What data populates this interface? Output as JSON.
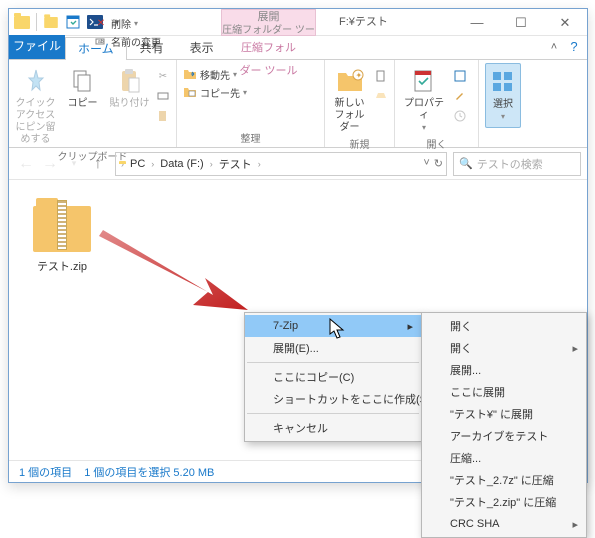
{
  "titlebar": {
    "contextual_header": "展開",
    "contextual_sub": "圧縮フォルダー ツール",
    "title": "F:¥テスト"
  },
  "winbtns": {
    "min": "—",
    "max": "☐",
    "close": "✕"
  },
  "tabs": {
    "file": "ファイル",
    "home": "ホーム",
    "share": "共有",
    "view": "表示"
  },
  "ribbon": {
    "clipboard": {
      "label": "クリップボード",
      "pin": "クイック アクセス\nにピン留めする",
      "copy": "コピー",
      "paste": "貼り付け"
    },
    "organize": {
      "label": "整理",
      "moveto": "移動先",
      "delete": "削除",
      "copyto": "コピー先",
      "rename": "名前の変更"
    },
    "new": {
      "label": "新規",
      "newfolder": "新しい\nフォルダー"
    },
    "open": {
      "label": "開く",
      "properties": "プロパティ"
    },
    "select": {
      "label": "",
      "select": "選択"
    }
  },
  "address": {
    "pc": "PC",
    "drive": "Data (F:)",
    "folder": "テスト"
  },
  "search": {
    "placeholder": "テストの検索"
  },
  "file": {
    "name": "テスト.zip"
  },
  "ctx1": {
    "sevenzip": "7-Zip",
    "expand": "展開(E)...",
    "copyhere": "ここにコピー(C)",
    "shortcut": "ショートカットをここに作成(S)",
    "cancel": "キャンセル"
  },
  "ctx2": {
    "open1": "開く",
    "open2": "開く",
    "expand": "展開...",
    "expandhere": "ここに展開",
    "expandto": "\"テスト¥\" に展開",
    "archivetest": "アーカイブをテスト",
    "compress": "圧縮...",
    "compress7z": "\"テスト_2.7z\" に圧縮",
    "compresszip": "\"テスト_2.zip\" に圧縮",
    "crcsha": "CRC SHA"
  },
  "status": {
    "items": "1 個の項目",
    "selected": "1 個の項目を選択 5.20 MB"
  }
}
